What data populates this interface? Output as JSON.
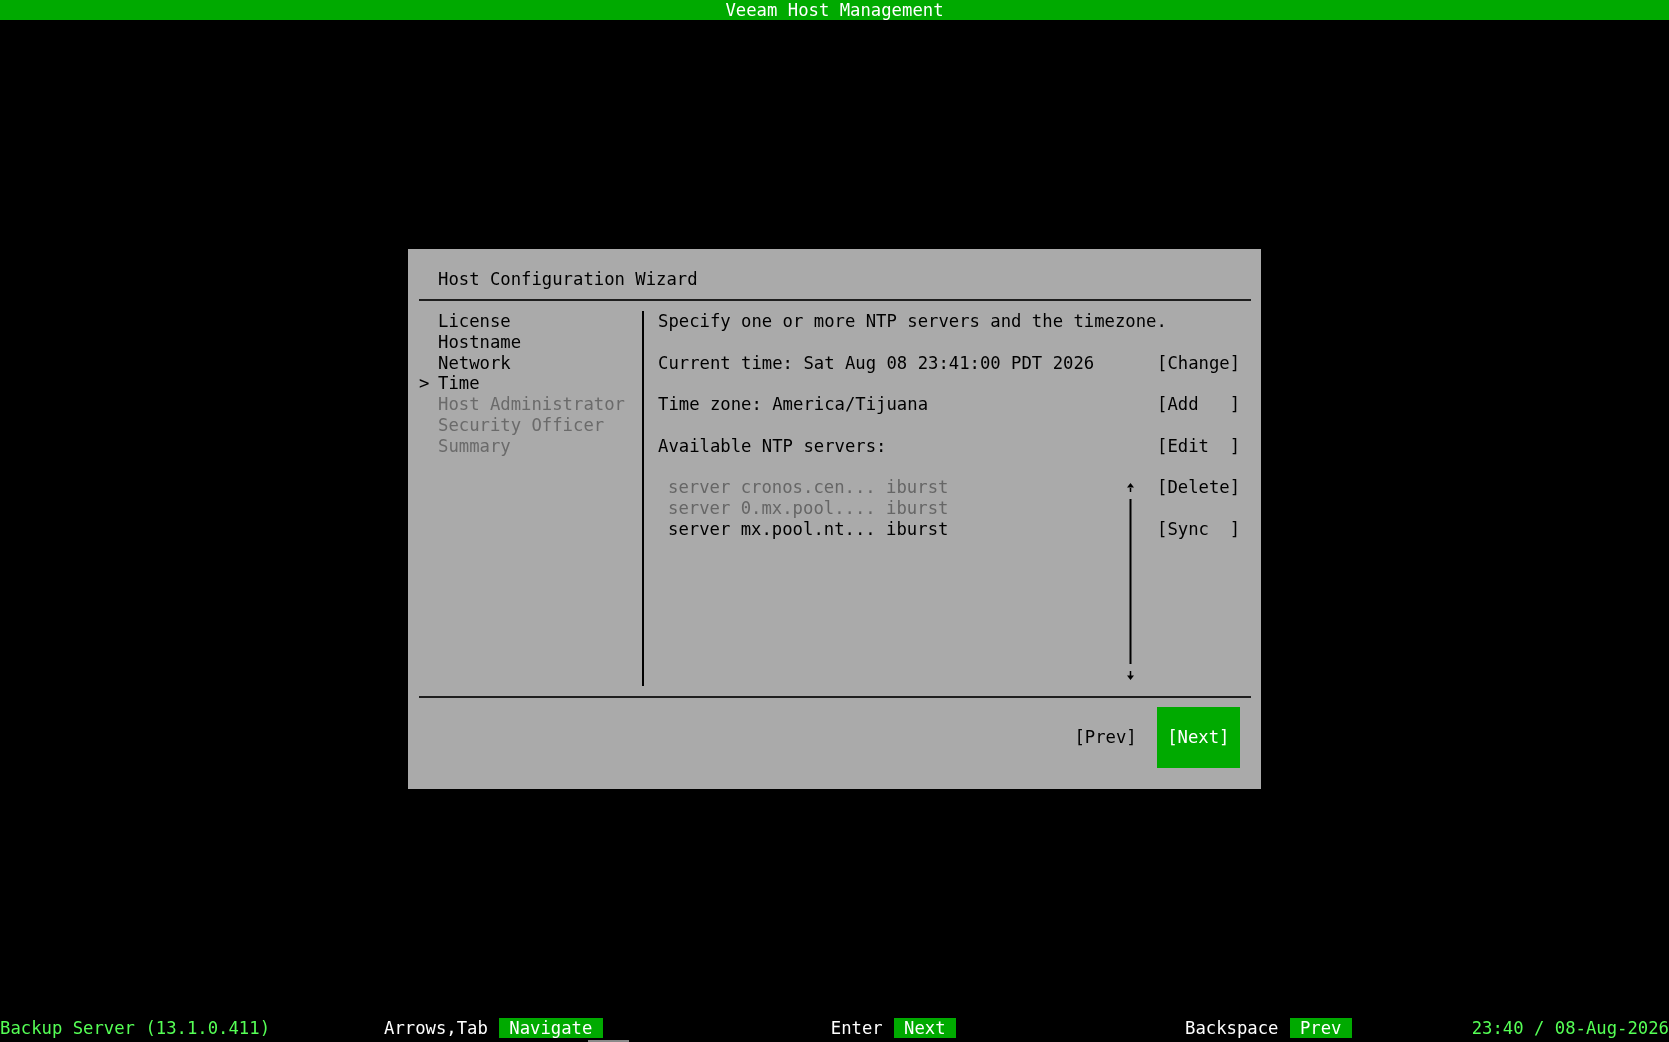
{
  "title_bar": {
    "title": "Veeam Host Management"
  },
  "wizard": {
    "title": "Host Configuration Wizard",
    "steps_marker": ">",
    "steps": [
      {
        "label": "License",
        "selected": false,
        "disabled": false
      },
      {
        "label": "Hostname",
        "selected": false,
        "disabled": false
      },
      {
        "label": "Network",
        "selected": false,
        "disabled": false
      },
      {
        "label": "Time",
        "selected": true,
        "disabled": false
      },
      {
        "label": "Host Administrator",
        "selected": false,
        "disabled": true
      },
      {
        "label": "Security Officer",
        "selected": false,
        "disabled": true
      },
      {
        "label": "Summary",
        "selected": false,
        "disabled": true
      }
    ],
    "instruction": "Specify one or more NTP servers and the timezone.",
    "current_time": "Current time: Sat Aug 08 23:41:00 PDT 2026",
    "time_zone": "Time zone: America/Tijuana",
    "ntp_heading": "Available NTP servers:",
    "ntp_servers": [
      {
        "text": "server cronos.cen... iburst",
        "selected": false
      },
      {
        "text": "server 0.mx.pool.... iburst",
        "selected": false
      },
      {
        "text": "server mx.pool.nt... iburst",
        "selected": true
      }
    ],
    "actions": [
      "[Change]",
      "[Add   ]",
      "[Edit  ]",
      "[Delete]",
      "[Sync  ]"
    ],
    "footer_buttons": [
      {
        "label": "[Prev]",
        "focused": false
      },
      {
        "label": "[Next]",
        "focused": true
      }
    ]
  },
  "status_bar": {
    "product": "Backup Server (13.1.0.411)",
    "hints": [
      {
        "key": "Arrows,Tab",
        "action": "Navigate"
      },
      {
        "key": "Enter",
        "action": "Next"
      },
      {
        "key": "Backspace",
        "action": "Prev"
      }
    ],
    "clock": "23:40 / 08-Aug-2026"
  }
}
